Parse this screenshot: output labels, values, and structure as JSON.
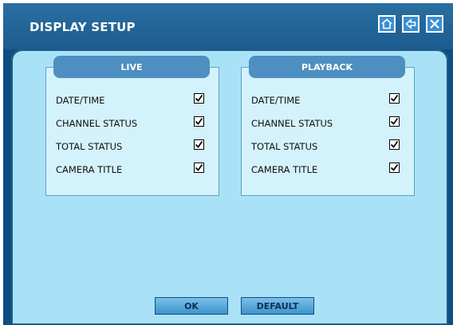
{
  "window": {
    "title": "DISPLAY SETUP",
    "controls": [
      {
        "icon": "home-icon"
      },
      {
        "icon": "back-arrow-icon"
      },
      {
        "icon": "close-icon"
      }
    ]
  },
  "live": {
    "header": "LIVE",
    "items": [
      {
        "label": "DATE/TIME",
        "checked": true
      },
      {
        "label": "CHANNEL STATUS",
        "checked": true
      },
      {
        "label": "TOTAL STATUS",
        "checked": true
      },
      {
        "label": "CAMERA TITLE",
        "checked": true
      }
    ]
  },
  "playback": {
    "header": "PLAYBACK",
    "items": [
      {
        "label": "DATE/TIME",
        "checked": true
      },
      {
        "label": "CHANNEL STATUS",
        "checked": true
      },
      {
        "label": "TOTAL STATUS",
        "checked": true
      },
      {
        "label": "CAMERA TITLE",
        "checked": true
      }
    ]
  },
  "buttons": {
    "ok": "OK",
    "default": "DEFAULT"
  },
  "colors": {
    "title_bar": "#1d5b8d",
    "content_bg": "#a9e2f7",
    "panel_bg": "#d4f2fb",
    "panel_header": "#4d8fc0",
    "button": "#3e93cc"
  }
}
